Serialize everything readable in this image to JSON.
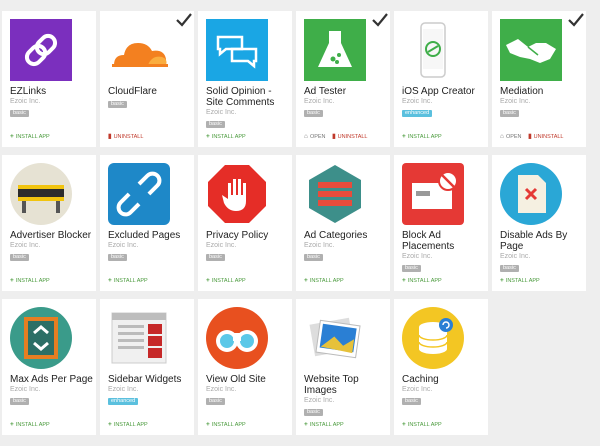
{
  "cards": [
    {
      "title": "EZLinks",
      "company": "Ezoic Inc.",
      "badge": "basic",
      "badge_type": "basic",
      "icon": "ezlinks-icon",
      "installed": false,
      "actions": [
        {
          "type": "install",
          "label": "INSTALL APP"
        }
      ]
    },
    {
      "title": "CloudFlare",
      "company": "",
      "badge": "basic",
      "badge_type": "basic",
      "icon": "cloudflare-icon",
      "installed": true,
      "actions": [
        {
          "type": "uninstall",
          "label": "UNINSTALL"
        }
      ]
    },
    {
      "title": "Solid Opinion - Site Comments",
      "company": "Ezoic Inc.",
      "badge": "basic",
      "badge_type": "basic",
      "icon": "comments-icon",
      "installed": false,
      "actions": [
        {
          "type": "install",
          "label": "INSTALL APP"
        }
      ]
    },
    {
      "title": "Ad Tester",
      "company": "Ezoic Inc.",
      "badge": "basic",
      "badge_type": "basic",
      "icon": "ad-tester-icon",
      "installed": true,
      "actions": [
        {
          "type": "open",
          "label": "OPEN"
        },
        {
          "type": "uninstall",
          "label": "UNINSTALL"
        }
      ]
    },
    {
      "title": "iOS App Creator",
      "company": "Ezoic Inc.",
      "badge": "enhanced",
      "badge_type": "enhanced",
      "icon": "ios-app-icon",
      "installed": false,
      "actions": [
        {
          "type": "install",
          "label": "INSTALL APP"
        }
      ]
    },
    {
      "title": "Mediation",
      "company": "Ezoic Inc.",
      "badge": "basic",
      "badge_type": "basic",
      "icon": "handshake-icon",
      "installed": true,
      "actions": [
        {
          "type": "open",
          "label": "OPEN"
        },
        {
          "type": "uninstall",
          "label": "UNINSTALL"
        }
      ]
    },
    {
      "title": "Advertiser Blocker",
      "company": "Ezoic Inc.",
      "badge": "basic",
      "badge_type": "basic",
      "icon": "advertisers-barrier-icon",
      "installed": false,
      "actions": [
        {
          "type": "install",
          "label": "INSTALL APP"
        }
      ]
    },
    {
      "title": "Excluded Pages",
      "company": "Ezoic Inc.",
      "badge": "basic",
      "badge_type": "basic",
      "icon": "broken-link-icon",
      "installed": false,
      "actions": [
        {
          "type": "install",
          "label": "INSTALL APP"
        }
      ]
    },
    {
      "title": "Privacy Policy",
      "company": "Ezoic Inc.",
      "badge": "basic",
      "badge_type": "basic",
      "icon": "stop-hand-icon",
      "installed": false,
      "actions": [
        {
          "type": "install",
          "label": "INSTALL APP"
        }
      ]
    },
    {
      "title": "Ad Categories",
      "company": "Ezoic Inc.",
      "badge": "basic",
      "badge_type": "basic",
      "icon": "ad-categories-icon",
      "installed": false,
      "actions": [
        {
          "type": "install",
          "label": "INSTALL APP"
        }
      ]
    },
    {
      "title": "Block Ad Placements",
      "company": "Ezoic Inc.",
      "badge": "basic",
      "badge_type": "basic",
      "icon": "block-ad-icon",
      "installed": false,
      "actions": [
        {
          "type": "install",
          "label": "INSTALL APP"
        }
      ]
    },
    {
      "title": "Disable Ads By Page",
      "company": "Ezoic Inc.",
      "badge": "basic",
      "badge_type": "basic",
      "icon": "disable-ads-page-icon",
      "installed": false,
      "actions": [
        {
          "type": "install",
          "label": "INSTALL APP"
        }
      ]
    },
    {
      "title": "Max Ads Per Page",
      "company": "Ezoic Inc.",
      "badge": "basic",
      "badge_type": "basic",
      "icon": "max-ads-icon",
      "installed": false,
      "actions": [
        {
          "type": "install",
          "label": "INSTALL APP"
        }
      ]
    },
    {
      "title": "Sidebar Widgets",
      "company": "Ezoic Inc.",
      "badge": "enhanced",
      "badge_type": "enhanced",
      "icon": "sidebar-widgets-icon",
      "installed": false,
      "actions": [
        {
          "type": "install",
          "label": "INSTALL APP"
        }
      ]
    },
    {
      "title": "View Old Site",
      "company": "Ezoic Inc.",
      "badge": "basic",
      "badge_type": "basic",
      "icon": "binoculars-icon",
      "installed": false,
      "actions": [
        {
          "type": "install",
          "label": "INSTALL APP"
        }
      ]
    },
    {
      "title": "Website Top Images",
      "company": "Ezoic Inc.",
      "badge": "basic",
      "badge_type": "basic",
      "icon": "photos-icon",
      "installed": false,
      "actions": [
        {
          "type": "install",
          "label": "INSTALL APP"
        }
      ]
    },
    {
      "title": "Caching",
      "company": "Ezoic Inc.",
      "badge": "basic",
      "badge_type": "basic",
      "icon": "database-icon",
      "installed": false,
      "actions": [
        {
          "type": "install",
          "label": "INSTALL APP"
        }
      ]
    }
  ]
}
